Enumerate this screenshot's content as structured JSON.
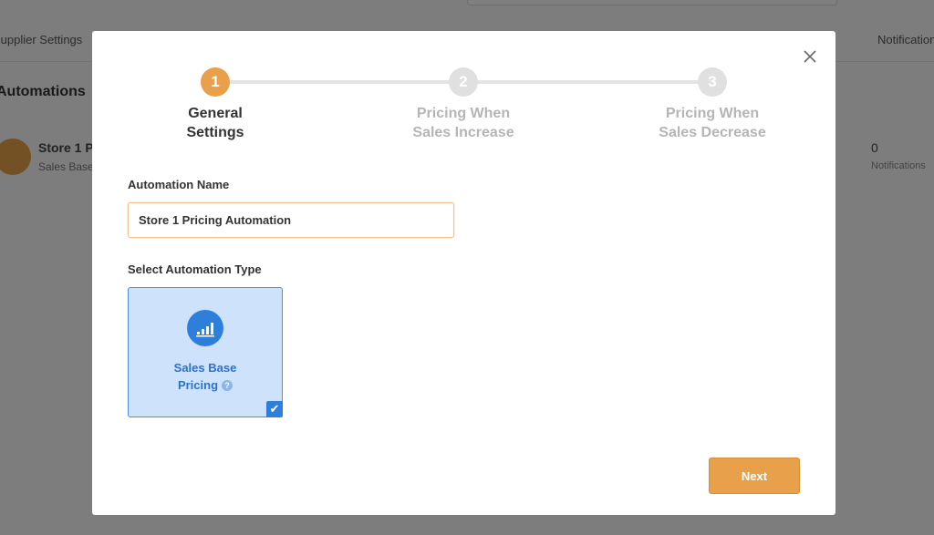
{
  "background": {
    "tabs": [
      "Supplier Settings",
      "Notifications"
    ],
    "heading": "Automations",
    "row": {
      "title": "Store 1 P",
      "subtitle": "Sales Base",
      "count": "0",
      "count_label": "Notifications"
    }
  },
  "modal": {
    "steps": [
      {
        "number": "1",
        "label_line1": "General",
        "label_line2": "Settings",
        "state": "active"
      },
      {
        "number": "2",
        "label_line1": "Pricing When",
        "label_line2": "Sales Increase",
        "state": "inactive"
      },
      {
        "number": "3",
        "label_line1": "Pricing When",
        "label_line2": "Sales Decrease",
        "state": "inactive"
      }
    ],
    "automation_name_label": "Automation Name",
    "automation_name_value": "Store 1 Pricing Automation",
    "automation_type_label": "Select Automation Type",
    "automation_types": [
      {
        "label_line1": "Sales Base",
        "label_line2": "Pricing",
        "icon": "bar-chart-icon",
        "selected": true
      }
    ],
    "help_glyph": "?",
    "check_glyph": "✔",
    "next_label": "Next"
  },
  "colors": {
    "accent": "#e8a04a",
    "selected_card_bg": "#cfe2fb",
    "selected_blue": "#2e7fdc"
  }
}
